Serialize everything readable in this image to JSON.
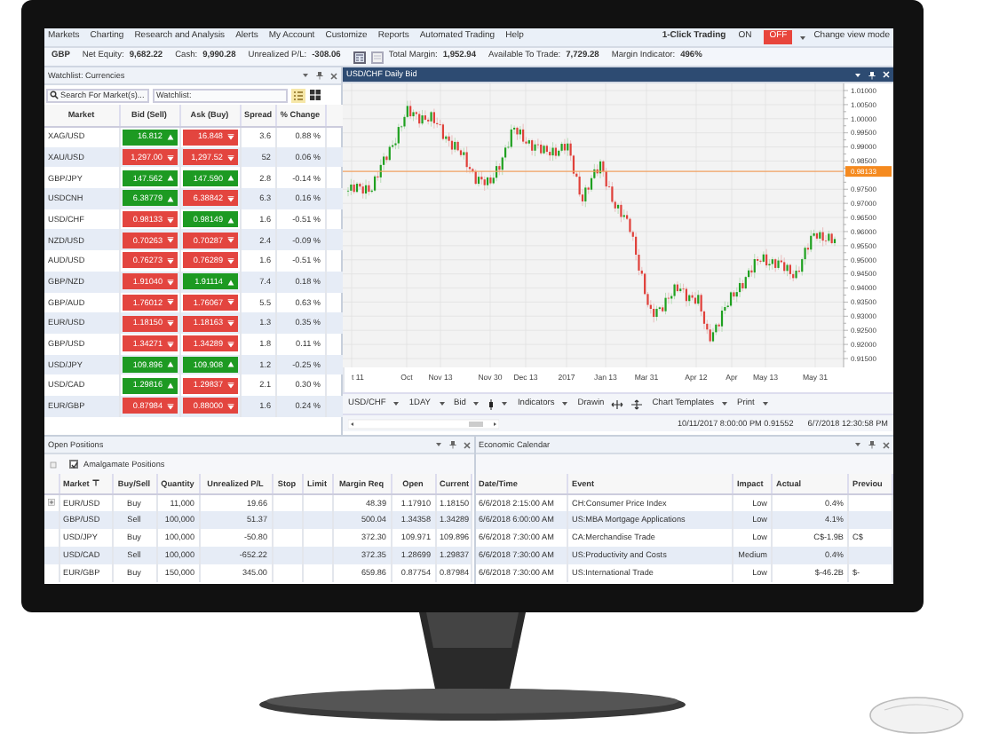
{
  "menu": {
    "items": [
      "Markets",
      "Charting",
      "Research and Analysis",
      "Alerts",
      "My Account",
      "Customize",
      "Reports",
      "Automated Trading",
      "Help"
    ],
    "one_click": {
      "label": "1-Click Trading",
      "options": [
        {
          "label": "ON",
          "selected": false
        },
        {
          "label": "OFF",
          "selected": true
        }
      ]
    },
    "view_mode": "Change view mode"
  },
  "account_bar": {
    "currency": "GBP",
    "metrics": [
      {
        "label": "Net Equity:",
        "value": "9,682.22"
      },
      {
        "label": "Cash:",
        "value": "9,990.28"
      },
      {
        "label": "Unrealized P/L:",
        "value": "-308.06"
      }
    ],
    "metrics_after_icons": [
      {
        "label": "Total Margin:",
        "value": "1,952.94"
      },
      {
        "label": "Available To Trade:",
        "value": "7,729.28"
      },
      {
        "label": "Margin Indicator:",
        "value": "496%"
      }
    ]
  },
  "watchlist": {
    "title": "Watchlist: Currencies",
    "search": {
      "placeholder": "Search For Market(s)..."
    },
    "list_label": "Watchlist:",
    "columns": [
      "Market",
      "Bid (Sell)",
      "Ask (Buy)",
      "Spread",
      "% Change"
    ],
    "rows": [
      {
        "market": "XAG/USD",
        "bid": {
          "value": "16.812",
          "up": true
        },
        "ask": {
          "value": "16.848",
          "up": false
        },
        "spread": "3.6",
        "change": "0.88 %"
      },
      {
        "market": "XAU/USD",
        "bid": {
          "value": "1,297.00",
          "up": false
        },
        "ask": {
          "value": "1,297.52",
          "up": false
        },
        "spread": "52",
        "change": "0.06 %"
      },
      {
        "market": "GBP/JPY",
        "bid": {
          "value": "147.562",
          "up": true
        },
        "ask": {
          "value": "147.590",
          "up": true
        },
        "spread": "2.8",
        "change": "-0.14 %"
      },
      {
        "market": "USDCNH",
        "bid": {
          "value": "6.38779",
          "up": true
        },
        "ask": {
          "value": "6.38842",
          "up": false
        },
        "spread": "6.3",
        "change": "0.16 %"
      },
      {
        "market": "USD/CHF",
        "bid": {
          "value": "0.98133",
          "up": false
        },
        "ask": {
          "value": "0.98149",
          "up": true
        },
        "spread": "1.6",
        "change": "-0.51 %"
      },
      {
        "market": "NZD/USD",
        "bid": {
          "value": "0.70263",
          "up": false
        },
        "ask": {
          "value": "0.70287",
          "up": false
        },
        "spread": "2.4",
        "change": "-0.09 %"
      },
      {
        "market": "AUD/USD",
        "bid": {
          "value": "0.76273",
          "up": false
        },
        "ask": {
          "value": "0.76289",
          "up": false
        },
        "spread": "1.6",
        "change": "-0.51 %"
      },
      {
        "market": "GBP/NZD",
        "bid": {
          "value": "1.91040",
          "up": false
        },
        "ask": {
          "value": "1.91114",
          "up": true
        },
        "spread": "7.4",
        "change": "0.18 %"
      },
      {
        "market": "GBP/AUD",
        "bid": {
          "value": "1.76012",
          "up": false
        },
        "ask": {
          "value": "1.76067",
          "up": false
        },
        "spread": "5.5",
        "change": "0.63 %"
      },
      {
        "market": "EUR/USD",
        "bid": {
          "value": "1.18150",
          "up": false
        },
        "ask": {
          "value": "1.18163",
          "up": false
        },
        "spread": "1.3",
        "change": "0.35 %"
      },
      {
        "market": "GBP/USD",
        "bid": {
          "value": "1.34271",
          "up": false
        },
        "ask": {
          "value": "1.34289",
          "up": false
        },
        "spread": "1.8",
        "change": "0.11 %"
      },
      {
        "market": "USD/JPY",
        "bid": {
          "value": "109.896",
          "up": true
        },
        "ask": {
          "value": "109.908",
          "up": true
        },
        "spread": "1.2",
        "change": "-0.25 %"
      },
      {
        "market": "USD/CAD",
        "bid": {
          "value": "1.29816",
          "up": true
        },
        "ask": {
          "value": "1.29837",
          "up": false
        },
        "spread": "2.1",
        "change": "0.30 %"
      },
      {
        "market": "EUR/GBP",
        "bid": {
          "value": "0.87984",
          "up": false
        },
        "ask": {
          "value": "0.88000",
          "up": false
        },
        "spread": "1.6",
        "change": "0.24 %"
      }
    ]
  },
  "chart": {
    "title": "USD/CHF Daily Bid",
    "y_labels": [
      "1.01000",
      "1.00500",
      "1.00000",
      "0.99500",
      "0.99000",
      "0.98500",
      "0.97500",
      "0.97000",
      "0.96500",
      "0.96000",
      "0.95500",
      "0.95000",
      "0.94500",
      "0.94000",
      "0.93500",
      "0.93000",
      "0.92500",
      "0.92000",
      "0.91500"
    ],
    "x_labels": [
      "t 11",
      "Oct",
      "Nov 13",
      "Nov 30",
      "Dec 13",
      "2017",
      "Jan 13",
      "Mar 31",
      "Apr 12",
      "Apr",
      "May 13",
      "May 31"
    ],
    "price_tag": "0.98133",
    "toolbar": [
      {
        "kind": "dropdown",
        "label": "USD/CHF"
      },
      {
        "kind": "dropdown",
        "label": "1DAY"
      },
      {
        "kind": "dropdown",
        "label": "Bid"
      },
      {
        "kind": "icon-dropdown"
      },
      {
        "kind": "dropdown",
        "label": "Indicators"
      },
      {
        "kind": "tools",
        "label": "Drawin"
      },
      {
        "kind": "dropdown",
        "label": "Chart Templates"
      },
      {
        "kind": "dropdown",
        "label": "Print"
      }
    ],
    "status": [
      "10/11/2017 8:00:00 PM 0.91552",
      "6/7/2018 12:30:58 PM"
    ]
  },
  "open_positions": {
    "title": "Open Positions",
    "amalgamate": {
      "label": "Amalgamate Positions",
      "checked": true
    },
    "columns": [
      "Market",
      "Buy/Sell",
      "Quantity",
      "Unrealized P/L",
      "Stop",
      "Limit",
      "Margin Req",
      "Open",
      "Current"
    ],
    "rows": [
      {
        "expandable": true,
        "cells": [
          "EUR/USD",
          "Buy",
          "11,000",
          "19.66",
          "",
          "",
          "48.39",
          "1.17910",
          "1.18150"
        ]
      },
      {
        "expandable": false,
        "cells": [
          "GBP/USD",
          "Sell",
          "100,000",
          "51.37",
          "",
          "",
          "500.04",
          "1.34358",
          "1.34289"
        ]
      },
      {
        "expandable": false,
        "cells": [
          "USD/JPY",
          "Buy",
          "100,000",
          "-50.80",
          "",
          "",
          "372.30",
          "109.971",
          "109.896"
        ]
      },
      {
        "expandable": false,
        "cells": [
          "USD/CAD",
          "Sell",
          "100,000",
          "-652.22",
          "",
          "",
          "372.35",
          "1.28699",
          "1.29837"
        ]
      },
      {
        "expandable": false,
        "cells": [
          "EUR/GBP",
          "Buy",
          "150,000",
          "345.00",
          "",
          "",
          "659.86",
          "0.87754",
          "0.87984"
        ]
      }
    ]
  },
  "economic_calendar": {
    "title": "Economic Calendar",
    "columns": [
      "Date/Time",
      "Event",
      "Impact",
      "Actual",
      "Previou"
    ],
    "rows": [
      [
        "6/6/2018 2:15:00 AM",
        "CH:Consumer Price Index",
        "Low",
        "0.4%",
        ""
      ],
      [
        "6/6/2018 6:00:00 AM",
        "US:MBA Mortgage Applications",
        "Low",
        "4.1%",
        ""
      ],
      [
        "6/6/2018 7:30:00 AM",
        "CA:Merchandise Trade",
        "Low",
        "C$-1.9B",
        "C$"
      ],
      [
        "6/6/2018 7:30:00 AM",
        "US:Productivity and Costs",
        "Medium",
        "0.4%",
        ""
      ],
      [
        "6/6/2018 7:30:00 AM",
        "US:International Trade",
        "Low",
        "$-46.2B",
        "$-"
      ]
    ]
  }
}
